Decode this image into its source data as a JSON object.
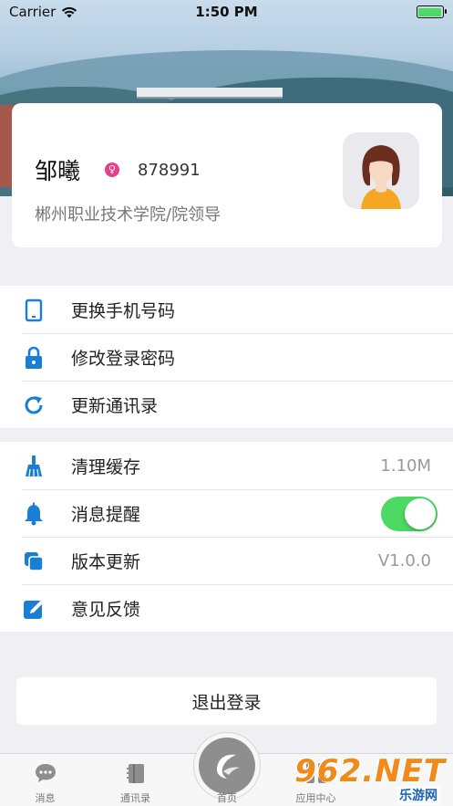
{
  "status_bar": {
    "carrier": "Carrier",
    "time": "1:50 PM"
  },
  "profile": {
    "name": "邹曦",
    "gender_symbol": "♀",
    "id": "878991",
    "organization": "郴州职业技术学院/院领导"
  },
  "account_menu": [
    {
      "label": "更换手机号码",
      "icon": "phone-icon"
    },
    {
      "label": "修改登录密码",
      "icon": "lock-icon"
    },
    {
      "label": "更新通讯录",
      "icon": "refresh-icon"
    }
  ],
  "settings_menu": {
    "clear_cache": {
      "label": "清理缓存",
      "value": "1.10M",
      "icon": "broom-icon"
    },
    "notifications": {
      "label": "消息提醒",
      "icon": "bell-icon",
      "enabled": true
    },
    "version": {
      "label": "版本更新",
      "value": "V1.0.0",
      "icon": "copy-icon"
    },
    "feedback": {
      "label": "意见反馈",
      "icon": "edit-icon"
    }
  },
  "logout_label": "退出登录",
  "tab_bar": {
    "messages": "消息",
    "contacts": "通讯录",
    "home": "首页",
    "apps": "应用中心"
  },
  "watermark": {
    "logo": "962.NET",
    "sub": "乐游网"
  },
  "colors": {
    "accent": "#1a7fd4",
    "toggle_on": "#4cd964",
    "gender_female": "#e73e8a"
  }
}
